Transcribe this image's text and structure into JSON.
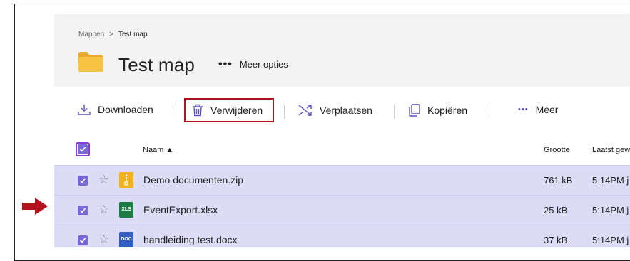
{
  "breadcrumb": {
    "root": "Mappen",
    "separator": ">",
    "current": "Test map"
  },
  "folder": {
    "title": "Test map",
    "more_options_label": "Meer opties",
    "dots": "•••"
  },
  "toolbar": {
    "download": "Downloaden",
    "delete": "Verwijderen",
    "move": "Verplaatsen",
    "copy": "Kopiëren",
    "more": "Meer",
    "more_dots": "•••"
  },
  "columns": {
    "name": "Naam ▲",
    "size": "Grootte",
    "modified": "Laatst gew"
  },
  "files": [
    {
      "name": "Demo documenten.zip",
      "size": "761 kB",
      "modified": "5:14PM j",
      "icon": "zip-file-icon",
      "badge": ""
    },
    {
      "name": "EventExport.xlsx",
      "size": "25 kB",
      "modified": "5:14PM j",
      "icon": "xls-file-icon",
      "badge": "XLS"
    },
    {
      "name": "handleiding test.docx",
      "size": "37 kB",
      "modified": "5:14PM j",
      "icon": "doc-file-icon",
      "badge": "DOC"
    }
  ],
  "colors": {
    "accent_purple": "#7a68d6",
    "selected_row": "#dcdcf7",
    "highlight_red": "#b3121f",
    "folder_yellow": "#f6c343"
  }
}
